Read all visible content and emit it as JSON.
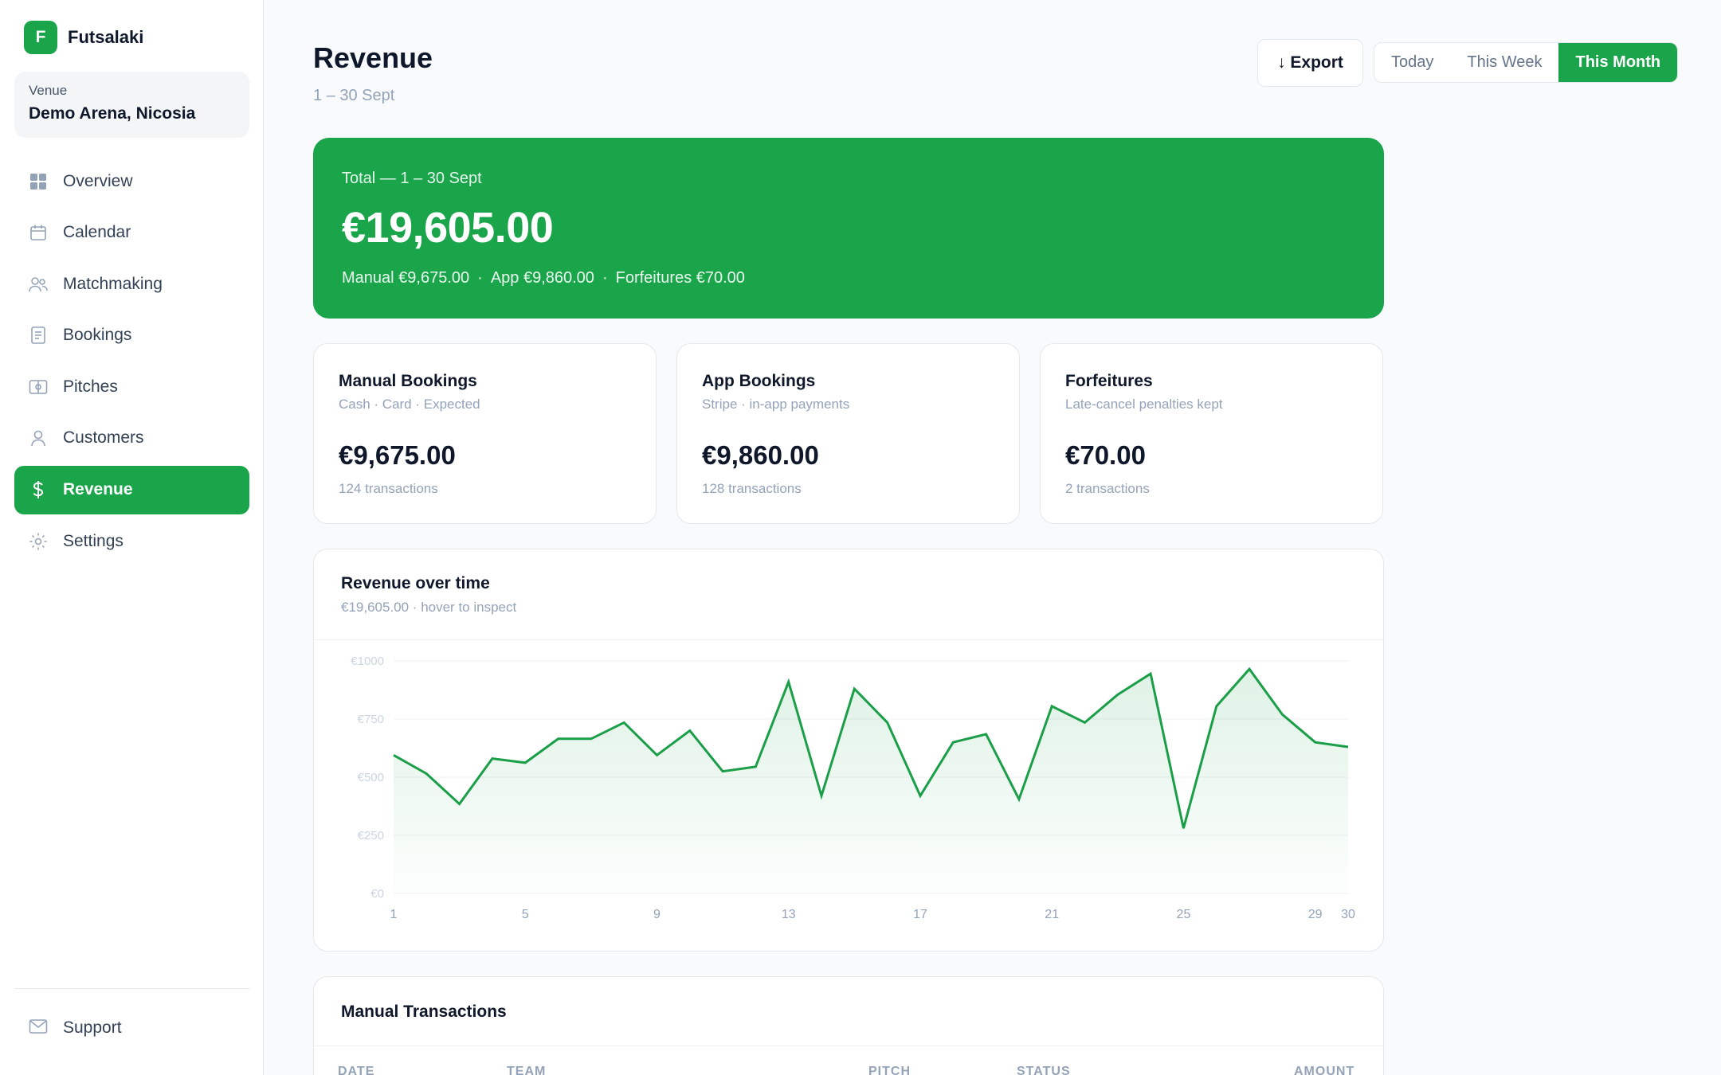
{
  "app": {
    "logo_letter": "F",
    "name": "Futsalaki"
  },
  "venue": {
    "label": "Venue",
    "name": "Demo Arena, Nicosia"
  },
  "nav": {
    "items": [
      {
        "label": "Overview",
        "icon": "grid-icon"
      },
      {
        "label": "Calendar",
        "icon": "calendar-icon"
      },
      {
        "label": "Matchmaking",
        "icon": "users-icon"
      },
      {
        "label": "Bookings",
        "icon": "document-icon"
      },
      {
        "label": "Pitches",
        "icon": "pitch-icon"
      },
      {
        "label": "Customers",
        "icon": "user-icon"
      },
      {
        "label": "Revenue",
        "icon": "dollar-icon",
        "active": true
      },
      {
        "label": "Settings",
        "icon": "gear-icon"
      }
    ],
    "support_label": "Support"
  },
  "header": {
    "title": "Revenue",
    "subtitle": "1 – 30 Sept",
    "export_label": "↓ Export",
    "ranges": [
      "Today",
      "This Week",
      "This Month"
    ],
    "selected_range": "This Month"
  },
  "total": {
    "label": "Total — 1 – 30 Sept",
    "amount": "€19,605.00",
    "manual": "Manual €9,675.00",
    "app": "App €9,860.00",
    "forfeitures": "Forfeitures €70.00",
    "separator": "·"
  },
  "stats": [
    {
      "title": "Manual Bookings",
      "subtitle": "Cash · Card · Expected",
      "value": "€9,675.00",
      "transactions": "124 transactions"
    },
    {
      "title": "App Bookings",
      "subtitle": "Stripe · in-app payments",
      "value": "€9,860.00",
      "transactions": "128 transactions"
    },
    {
      "title": "Forfeitures",
      "subtitle": "Late-cancel penalties kept",
      "value": "€70.00",
      "transactions": "2 transactions"
    }
  ],
  "chart": {
    "title": "Revenue over time",
    "subtitle": "€19,605.00 · hover to inspect",
    "line_color": "#1a9e48"
  },
  "chart_data": {
    "type": "area",
    "x": [
      1,
      2,
      3,
      4,
      5,
      6,
      7,
      8,
      9,
      10,
      11,
      12,
      13,
      14,
      15,
      16,
      17,
      18,
      19,
      20,
      21,
      22,
      23,
      24,
      25,
      26,
      27,
      28,
      29,
      30
    ],
    "series": [
      {
        "values": [
          595,
          515,
          385,
          580,
          562,
          665,
          665,
          735,
          595,
          700,
          525,
          545,
          910,
          420,
          880,
          735,
          420,
          650,
          685,
          405,
          805,
          735,
          855,
          945,
          280,
          805,
          965,
          770,
          650,
          630
        ]
      }
    ],
    "ylim": [
      0,
      1000
    ],
    "yticks": [
      "€0",
      "€250",
      "€500",
      "€750",
      "€1000"
    ],
    "ytick_values": [
      0,
      250,
      500,
      750,
      1000
    ],
    "xticks": [
      "1",
      "5",
      "9",
      "13",
      "17",
      "21",
      "25",
      "29",
      "30"
    ],
    "xtick_values": [
      1,
      5,
      9,
      13,
      17,
      21,
      25,
      29,
      30
    ],
    "grid": true
  },
  "transactions": {
    "title": "Manual Transactions",
    "columns": [
      "DATE",
      "TEAM",
      "PITCH",
      "STATUS",
      "AMOUNT"
    ]
  },
  "colors": {
    "accent": "#1aa54b",
    "text": "#0f172a",
    "muted": "#94a3b8"
  }
}
